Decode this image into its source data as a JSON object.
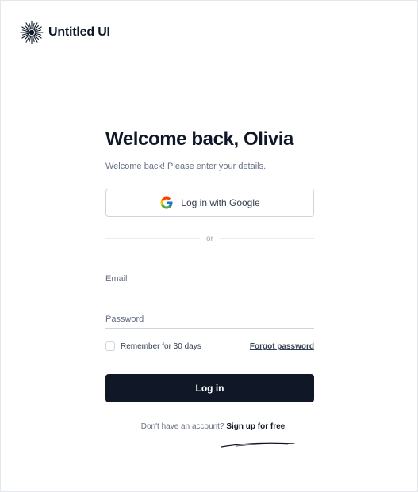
{
  "brand": {
    "name": "Untitled UI",
    "logo_icon": "starburst-logo-icon"
  },
  "form": {
    "title": "Welcome back, Olivia",
    "subtitle": "Welcome back! Please enter your details.",
    "google_button_label": "Log in with Google",
    "google_icon": "google-icon",
    "divider_text": "or",
    "email_placeholder": "Email",
    "password_placeholder": "Password",
    "remember_label": "Remember for 30 days",
    "remember_checked": false,
    "forgot_password_label": "Forgot password",
    "login_button_label": "Log in",
    "signup_prompt": "Don't have an account?",
    "signup_link_label": "Sign up for free"
  },
  "colors": {
    "primary": "#101828",
    "muted_text": "#667085",
    "border": "#d0d5dd",
    "background": "#ffffff"
  }
}
